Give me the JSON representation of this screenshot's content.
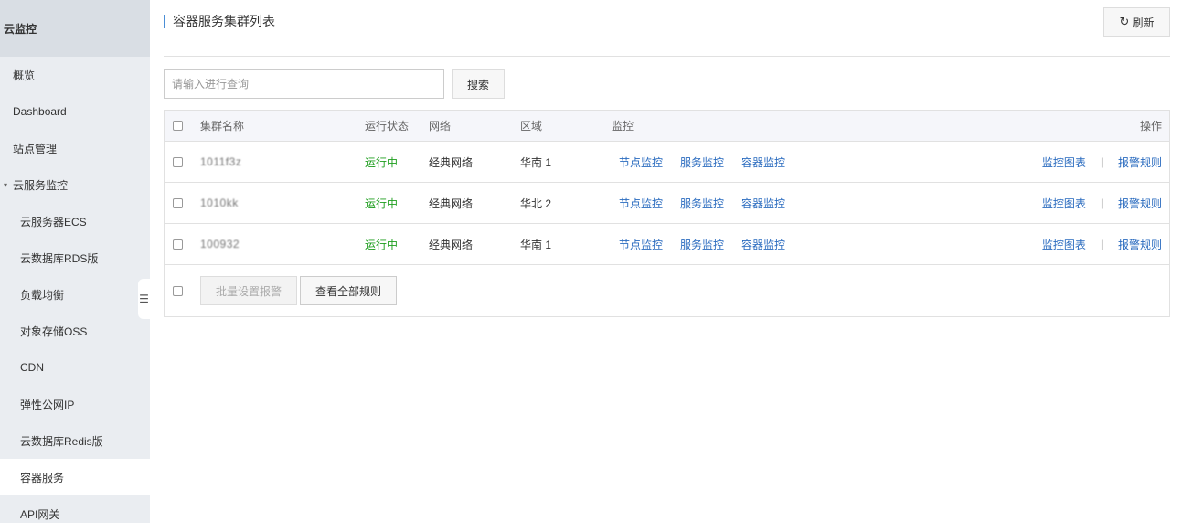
{
  "sidebar": {
    "title": "云监控",
    "items": [
      {
        "label": "概览"
      },
      {
        "label": "Dashboard"
      },
      {
        "label": "站点管理"
      },
      {
        "label": "云服务监控"
      },
      {
        "label": "云服务器ECS"
      },
      {
        "label": "云数据库RDS版"
      },
      {
        "label": "负载均衡"
      },
      {
        "label": "对象存储OSS"
      },
      {
        "label": "CDN"
      },
      {
        "label": "弹性公网IP"
      },
      {
        "label": "云数据库Redis版"
      },
      {
        "label": "容器服务"
      },
      {
        "label": "API网关"
      }
    ],
    "group_caret": "▾",
    "collapse_icon": "☰"
  },
  "header": {
    "title": "容器服务集群列表",
    "refresh_icon": "↻",
    "refresh_label": "刷新"
  },
  "search": {
    "placeholder": "请输入进行查询",
    "value": "",
    "button_label": "搜索"
  },
  "table": {
    "columns": {
      "name": "集群名称",
      "status": "运行状态",
      "network": "网络",
      "region": "区域",
      "monitor": "监控",
      "actions": "操作"
    },
    "rows": [
      {
        "name": "1011f3z",
        "status": "运行中",
        "network": "经典网络",
        "region": "华南 1",
        "node_monitor": "节点监控",
        "service_monitor": "服务监控",
        "container_monitor": "容器监控",
        "chart": "监控图表",
        "alert_rules": "报警规则"
      },
      {
        "name": "1010kk",
        "status": "运行中",
        "network": "经典网络",
        "region": "华北 2",
        "node_monitor": "节点监控",
        "service_monitor": "服务监控",
        "container_monitor": "容器监控",
        "chart": "监控图表",
        "alert_rules": "报警规则"
      },
      {
        "name": "100932",
        "status": "运行中",
        "network": "经典网络",
        "region": "华南 1",
        "node_monitor": "节点监控",
        "service_monitor": "服务监控",
        "container_monitor": "容器监控",
        "chart": "监控图表",
        "alert_rules": "报警规则"
      }
    ],
    "action_separator": "|"
  },
  "footer": {
    "batch_alert_label": "批量设置报警",
    "view_all_rules_label": "查看全部规则"
  },
  "colors": {
    "link": "#2a6bbf",
    "running": "#1e9e1e",
    "sidebar_bg": "#eaedf1",
    "title_accent": "#4a8ed6"
  }
}
